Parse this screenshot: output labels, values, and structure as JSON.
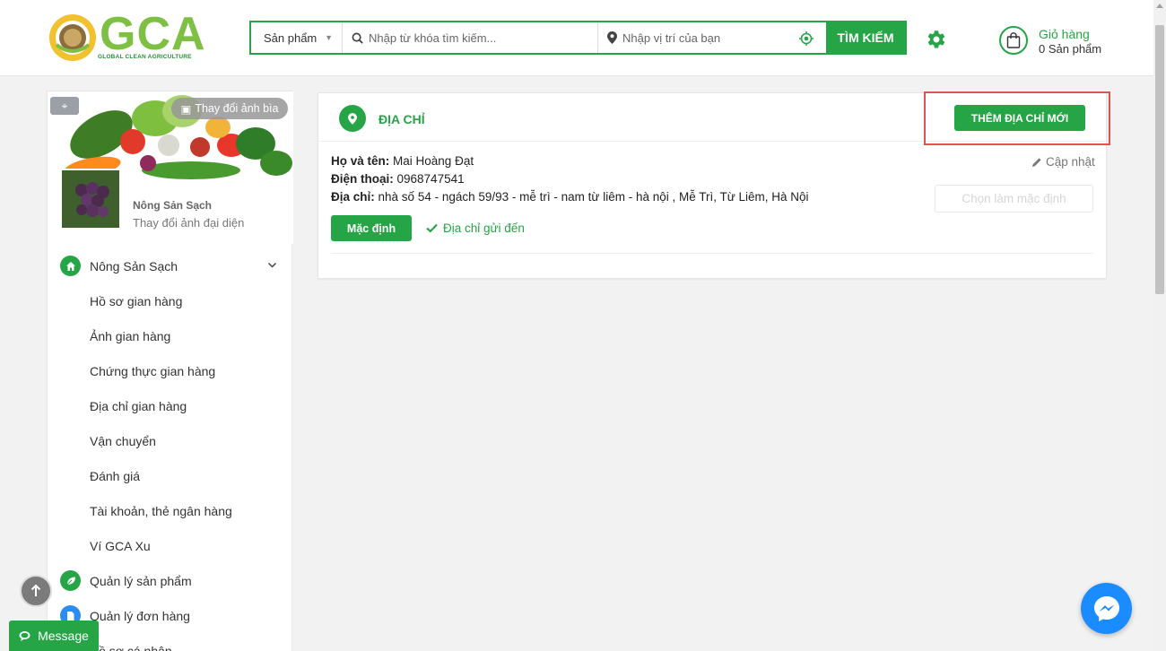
{
  "brand": {
    "logo_text": "GCA",
    "logo_subtitle": "GLOBAL CLEAN AGRICULTURE",
    "accent": "#26a546"
  },
  "search": {
    "category": "Sản phẩm",
    "keyword_placeholder": "Nhập từ khóa tìm kiếm...",
    "location_placeholder": "Nhập vị trí của bạn",
    "button": "TÌM KIẾM"
  },
  "cart": {
    "title": "Giỏ hàng",
    "count_text": "0 Sản phẩm"
  },
  "sidebar": {
    "change_cover": "Thay đổi ảnh bìa",
    "shop_name": "Nông Sản Sạch",
    "change_avatar": "Thay đổi ảnh đại diện",
    "section": {
      "label": "Nông Sản Sạch",
      "icon": "home-icon"
    },
    "items": [
      "Hồ sơ gian hàng",
      "Ảnh gian hàng",
      "Chứng thực gian hàng",
      "Địa chỉ gian hàng",
      "Vận chuyển",
      "Đánh giá",
      "Tài khoản, thẻ ngân hàng",
      "Ví GCA Xu"
    ],
    "sections": [
      {
        "label": "Quản lý sản phẩm",
        "icon": "leaf-icon",
        "color": "#26a546"
      },
      {
        "label": "Quản lý đơn hàng",
        "icon": "document-icon",
        "color": "#2d8cf0"
      },
      {
        "label": "Hồ sơ cá nhân",
        "icon": "user-icon",
        "color": "#26a546"
      }
    ]
  },
  "address_panel": {
    "title": "ĐỊA CHỈ",
    "add_button": "THÊM ĐỊA CHỈ MỚI",
    "name_label": "Họ và tên:",
    "name_value": "Mai Hoàng Đạt",
    "phone_label": "Điện thoại:",
    "phone_value": "0968747541",
    "address_label": "Địa chỉ:",
    "address_value": "nhà số 54 - ngách 59/93 - mễ trì - nam từ liêm - hà nội , Mễ Trì, Từ Liêm, Hà Nội",
    "update": "Cập nhật",
    "set_default": "Chọn làm mặc định",
    "default_badge": "Mặc định",
    "ship_to": "Địa chỉ gửi đến"
  },
  "floating": {
    "message": "Message"
  }
}
